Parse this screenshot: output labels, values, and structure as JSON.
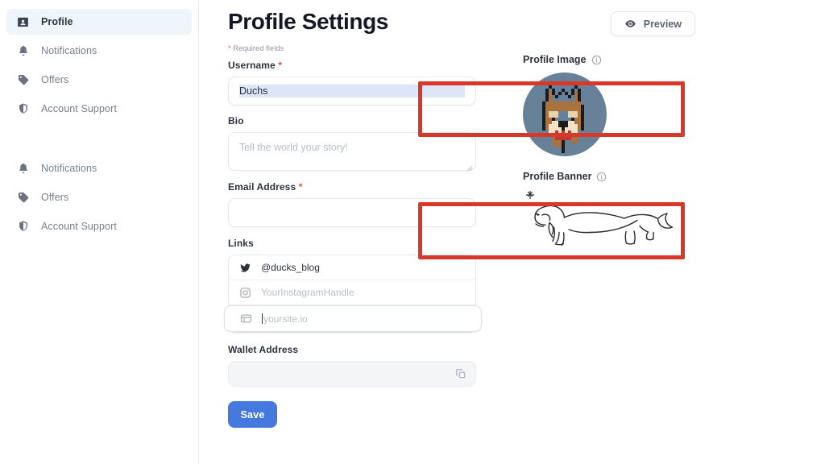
{
  "sidebar": {
    "primary_items": [
      {
        "id": "profile",
        "label": "Profile",
        "icon": "contact-card-icon",
        "active": true
      },
      {
        "id": "notifications",
        "label": "Notifications",
        "icon": "bell-icon",
        "active": false
      },
      {
        "id": "offers",
        "label": "Offers",
        "icon": "tag-icon",
        "active": false
      },
      {
        "id": "account-support",
        "label": "Account Support",
        "icon": "shield-icon",
        "active": false
      }
    ],
    "secondary_items": [
      {
        "id": "notifications-2",
        "label": "Notifications",
        "icon": "bell-icon"
      },
      {
        "id": "offers-2",
        "label": "Offers",
        "icon": "tag-icon"
      },
      {
        "id": "account-support-2",
        "label": "Account Support",
        "icon": "shield-icon"
      }
    ]
  },
  "header": {
    "title": "Profile Settings",
    "preview_label": "Preview",
    "preview_icon": "eye-icon"
  },
  "form": {
    "required_note_star": "*",
    "required_note_text": "Required fields",
    "username": {
      "label": "Username",
      "required_marker": "*",
      "value": "Duchs",
      "selected": true
    },
    "bio": {
      "label": "Bio",
      "value": "",
      "placeholder": "Tell the world your story!"
    },
    "email": {
      "label": "Email Address",
      "required_marker": "*",
      "value": "",
      "placeholder": ""
    },
    "links": {
      "label": "Links",
      "rows": [
        {
          "id": "twitter",
          "icon": "twitter-icon",
          "value": "@ducks_blog",
          "is_placeholder": false,
          "focused": false
        },
        {
          "id": "instagram",
          "icon": "instagram-icon",
          "value": "YourInstagramHandle",
          "is_placeholder": true,
          "focused": false
        },
        {
          "id": "website",
          "icon": "browser-icon",
          "value": "yoursite.io",
          "is_placeholder": true,
          "focused": true
        }
      ]
    },
    "wallet": {
      "label": "Wallet Address",
      "value": "",
      "copy_icon": "copy-icon"
    },
    "save_label": "Save"
  },
  "media": {
    "profile_image": {
      "label": "Profile Image",
      "info_icon": "info-icon",
      "alt": "pixel-art dog avatar",
      "background_color": "#678199"
    },
    "profile_banner": {
      "label": "Profile Banner",
      "info_icon": "info-icon",
      "alt": "line drawing of a dachshund with sparkle"
    }
  },
  "annotations": {
    "boxes": [
      {
        "id": "username-highlight",
        "target": "Username",
        "color": "#d8382a"
      },
      {
        "id": "email-highlight",
        "target": "Email Address",
        "color": "#d8382a"
      }
    ]
  },
  "colors": {
    "accent_blue": "#4579dd",
    "annotation_red": "#d8382a",
    "required_red": "#e0544a",
    "active_nav_bg": "#eff6fb",
    "selection_blue": "#dde6f6"
  }
}
